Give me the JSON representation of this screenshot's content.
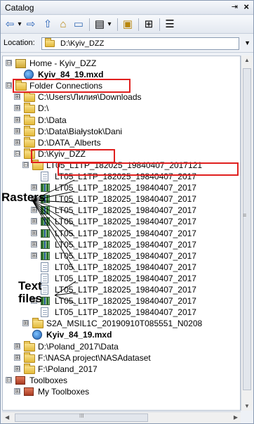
{
  "window": {
    "title": "Catalog",
    "pin_glyph": "⇥",
    "close_glyph": "×"
  },
  "toolbar": {
    "back": "⇦",
    "back_drop": "▾",
    "forward": "⇨",
    "up": "⇧",
    "home": "⌂",
    "connect": "▭",
    "view": "▤",
    "view_drop": "▾",
    "new": "▣",
    "search": "⊞",
    "options": "☰"
  },
  "location": {
    "label": "Location:",
    "value": "D:\\Kyiv_DZZ"
  },
  "tree": [
    {
      "expander": "⊟",
      "icon": "home",
      "label": "Home - Kyiv_DZZ",
      "bold": false
    },
    {
      "expander": "",
      "icon": "mxd",
      "label": "Kyiv_84_19.mxd",
      "bold": true
    },
    {
      "expander": "⊟",
      "icon": "folder",
      "label": "Folder Connections",
      "bold": false
    },
    {
      "expander": "⊞",
      "icon": "folder",
      "label": "C:\\Users\\Лилия\\Downloads",
      "bold": false
    },
    {
      "expander": "⊞",
      "icon": "folder",
      "label": "D:\\",
      "bold": false
    },
    {
      "expander": "⊞",
      "icon": "folder",
      "label": "D:\\Data",
      "bold": false
    },
    {
      "expander": "⊞",
      "icon": "folder",
      "label": "D:\\Data\\Białystok\\Dani",
      "bold": false
    },
    {
      "expander": "⊞",
      "icon": "folder",
      "label": "D:\\DATA_Alberts",
      "bold": false
    },
    {
      "expander": "⊟",
      "icon": "folder",
      "label": "D:\\Kyiv_DZZ",
      "bold": false
    },
    {
      "expander": "⊟",
      "icon": "folder",
      "label": "LT05_L1TP_182025_19840407_2017121",
      "bold": false
    },
    {
      "expander": "",
      "icon": "textfile",
      "label": "LT05_L1TP_182025_19840407_2017",
      "bold": false
    },
    {
      "expander": "⊞",
      "icon": "raster",
      "label": "LT05_L1TP_182025_19840407_2017",
      "bold": false
    },
    {
      "expander": "⊞",
      "icon": "raster",
      "label": "LT05_L1TP_182025_19840407_2017",
      "bold": false
    },
    {
      "expander": "⊞",
      "icon": "raster",
      "label": "LT05_L1TP_182025_19840407_2017",
      "bold": false
    },
    {
      "expander": "⊞",
      "icon": "raster",
      "label": "LT05_L1TP_182025_19840407_2017",
      "bold": false
    },
    {
      "expander": "⊞",
      "icon": "raster",
      "label": "LT05_L1TP_182025_19840407_2017",
      "bold": false
    },
    {
      "expander": "⊞",
      "icon": "raster",
      "label": "LT05_L1TP_182025_19840407_2017",
      "bold": false
    },
    {
      "expander": "⊞",
      "icon": "raster",
      "label": "LT05_L1TP_182025_19840407_2017",
      "bold": false
    },
    {
      "expander": "",
      "icon": "textfile",
      "label": "LT05_L1TP_182025_19840407_2017",
      "bold": false
    },
    {
      "expander": "",
      "icon": "textfile",
      "label": "LT05_L1TP_182025_19840407_2017",
      "bold": false
    },
    {
      "expander": "",
      "icon": "textfile",
      "label": "LT05_L1TP_182025_19840407_2017",
      "bold": false
    },
    {
      "expander": "⊞",
      "icon": "raster",
      "label": "LT05_L1TP_182025_19840407_2017",
      "bold": false
    },
    {
      "expander": "",
      "icon": "textfile",
      "label": "LT05_L1TP_182025_19840407_2017",
      "bold": false
    },
    {
      "expander": "⊞",
      "icon": "folder",
      "label": "S2A_MSIL1C_20190910T085551_N0208",
      "bold": false
    },
    {
      "expander": "",
      "icon": "mxd",
      "label": "Kyiv_84_19.mxd",
      "bold": true
    },
    {
      "expander": "⊞",
      "icon": "folder",
      "label": "D:\\Poland_2017\\Data",
      "bold": false
    },
    {
      "expander": "⊞",
      "icon": "folder",
      "label": "F:\\NASA project\\NASAdataset",
      "bold": false
    },
    {
      "expander": "⊞",
      "icon": "folder",
      "label": "F:\\Poland_2017",
      "bold": false
    },
    {
      "expander": "⊟",
      "icon": "toolbox",
      "label": "Toolboxes",
      "bold": false
    },
    {
      "expander": "⊞",
      "icon": "toolbox",
      "label": "My Toolboxes",
      "bold": false
    }
  ],
  "annotations": {
    "rasters": "Rasters",
    "text_files": "Text\nfiles"
  },
  "scrollbar": {
    "up": "▲",
    "down": "▼",
    "left": "◀",
    "right": "▶",
    "grip": "≡",
    "hgrip": "III"
  },
  "colors": {
    "highlight": "#e0201f"
  }
}
